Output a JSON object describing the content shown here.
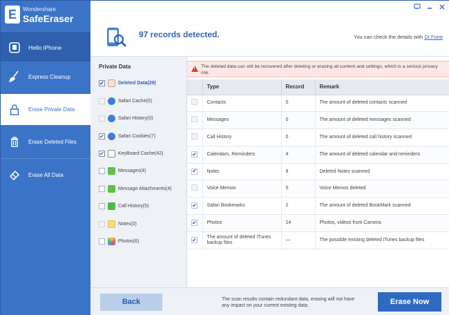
{
  "brand": {
    "small": "Wondershare",
    "big": "SafeEraser",
    "mark": "E"
  },
  "window_controls": [
    "feedback-icon",
    "minimize-icon",
    "close-icon"
  ],
  "sidebar": {
    "hello": "Hello iPhone",
    "items": [
      {
        "label": "Express Cleanup",
        "icon": "broom-icon"
      },
      {
        "label": "Erase Private Data",
        "icon": "lock-icon"
      },
      {
        "label": "Erase Deleted Files",
        "icon": "trash-icon"
      },
      {
        "label": "Erase All Data",
        "icon": "eraser-icon"
      }
    ],
    "active": "Erase Private Data"
  },
  "header": {
    "records": "97 records detected.",
    "hint": "You can check the details with ",
    "hint_link": "Dr.Fone"
  },
  "private_panel": {
    "title": "Private Data",
    "items": [
      {
        "label": "Deleted Data(29)",
        "checked": true,
        "selected": true,
        "color": "#c0392b"
      },
      {
        "label": "Safari Cache(0)",
        "checked": false,
        "color": "#3d7fd6"
      },
      {
        "label": "Safari History(0)",
        "checked": false,
        "color": "#3d7fd6"
      },
      {
        "label": "Safari Cookies(7)",
        "checked": true,
        "color": "#3d7fd6"
      },
      {
        "label": "KeyBoard Cache(42)",
        "checked": true,
        "color": "#6d6d6d"
      },
      {
        "label": "Messages(4)",
        "checked": false,
        "color": "#5bc14a"
      },
      {
        "label": "Message Attachments(4)",
        "checked": false,
        "color": "#5bc14a"
      },
      {
        "label": "Call History(5)",
        "checked": false,
        "color": "#4cb848"
      },
      {
        "label": "Notes(0)",
        "checked": false,
        "color": "#f1c64a"
      },
      {
        "label": "Photos(6)",
        "checked": false,
        "color": "#e9744a"
      }
    ]
  },
  "warning": "The deleted data can still be recovered after deleting or erasing all content and settings, which is a serious privacy risk.",
  "table": {
    "headers": [
      "Type",
      "Record",
      "Remark"
    ],
    "rows": [
      {
        "type": "Contacts",
        "record": "0",
        "remark": "The amount of deleted contacts scanned",
        "checked": false
      },
      {
        "type": "Messages",
        "record": "0",
        "remark": "The amount of deleted messages scanned",
        "checked": false
      },
      {
        "type": "Call History",
        "record": "0",
        "remark": "The amount of deleted call history scanned",
        "checked": false
      },
      {
        "type": "Calendars, Reminders",
        "record": "4",
        "remark": "The amount of deleted calendar and reminders",
        "checked": true
      },
      {
        "type": "Notes",
        "record": "9",
        "remark": "Deleted Notes scanned",
        "checked": true
      },
      {
        "type": "Voice Memos",
        "record": "0",
        "remark": "Voice Memos deleted",
        "checked": false
      },
      {
        "type": "Safari Bookmarks",
        "record": "2",
        "remark": "The amount of deleted BookMark scanned",
        "checked": true
      },
      {
        "type": "Photos",
        "record": "14",
        "remark": "Photos, videos from Camera.",
        "checked": true
      },
      {
        "type": "The amount of deleted iTunes backup files",
        "record": "—",
        "remark": "The possible existing deleted iTunes backup files",
        "checked": true
      }
    ]
  },
  "footer": {
    "back": "Back",
    "note": "The scan results contain redundant data, erasing will not have any impact on your current existing data.",
    "erase": "Erase Now"
  }
}
